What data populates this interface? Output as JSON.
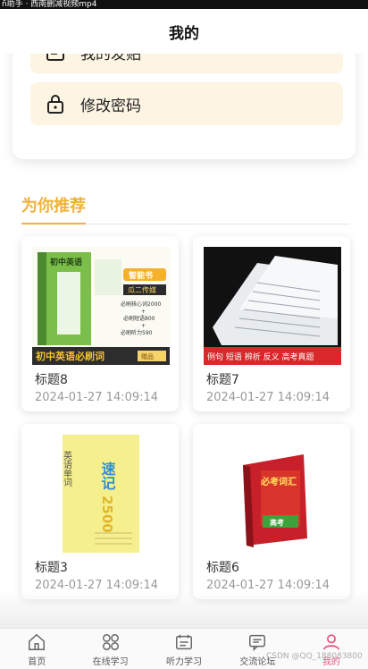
{
  "status_bar": {
    "text": "ñ助手 · 西南删减视频mp4"
  },
  "header": {
    "title": "我的"
  },
  "menu": {
    "items": [
      {
        "label": "我的发贴",
        "icon": "document-icon"
      },
      {
        "label": "修改密码",
        "icon": "lock-icon"
      }
    ]
  },
  "recommend": {
    "title": "为你推荐",
    "cards": [
      {
        "title": "标题8",
        "date": "2024-01-27 14:09:14",
        "cover": {
          "top_banner": "初中英语",
          "side": "智能书",
          "subtitle": "瓜二传媒",
          "lines": [
            "必刷核心词2000",
            "+",
            "必刷短语800",
            "+",
            "必刷听力590"
          ],
          "bottom": "初中英语必刷词",
          "badge": "赠品"
        }
      },
      {
        "title": "标题7",
        "date": "2024-01-27 14:09:14",
        "cover": {
          "bottom": "例句 短语 辨析 反义 高考真题"
        }
      },
      {
        "title": "标题3",
        "date": "2024-01-27 14:09:14",
        "cover": {
          "left": "英语单词",
          "main": "速记",
          "number": "2500"
        }
      },
      {
        "title": "标题6",
        "date": "2024-01-27 14:09:14",
        "cover": {
          "main": "必考词汇",
          "badge": "高考"
        }
      }
    ]
  },
  "tabbar": {
    "tabs": [
      {
        "label": "首页",
        "icon": "home-icon"
      },
      {
        "label": "在线学习",
        "icon": "grid-icon"
      },
      {
        "label": "听力学习",
        "icon": "headphone-icon"
      },
      {
        "label": "交流论坛",
        "icon": "chat-icon"
      },
      {
        "label": "我的",
        "icon": "user-icon"
      }
    ],
    "active_index": 4,
    "active_color": "#e8527b"
  },
  "watermark": "CSDN @QQ_188083800",
  "colors": {
    "accent": "#f0b23a",
    "menu_bg": "#fdf4e2"
  }
}
